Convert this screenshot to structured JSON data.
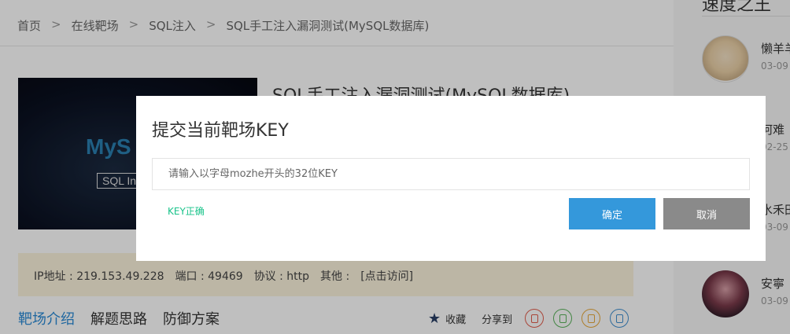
{
  "breadcrumb": {
    "items": [
      "首页",
      "在线靶场",
      "SQL注入",
      "SQL手工注入漏洞测试(MySQL数据库)"
    ],
    "separator": ">"
  },
  "hero": {
    "logo_text": "MyS",
    "sub_text": "SQL In"
  },
  "page_title": "SQL手工注入漏洞测试(MySQL数据库)",
  "info": {
    "ip": "IP地址 : 219.153.49.228",
    "port": "端口 : 49469",
    "protocol": "协议 : http",
    "other_label": "其他 :",
    "visit_link": "[点击访问]"
  },
  "tabs": [
    "靶场介绍",
    "解题思路",
    "防御方案"
  ],
  "actions": {
    "favorite_label": "收藏",
    "share_label": "分享到",
    "share_colors": [
      "#e25c4b",
      "#59b35a",
      "#e8a93a",
      "#3f8fd1"
    ],
    "share_icons": [
      "weibo-icon",
      "wechat-icon",
      "qzone-icon",
      "qq-icon"
    ]
  },
  "sidebar": {
    "title": "速度之王",
    "items": [
      {
        "name": "懒羊羊",
        "date": "03-09"
      },
      {
        "name": "何难",
        "date": "02-25"
      },
      {
        "name": "水禾田",
        "date": "03-09"
      },
      {
        "name": "安寧",
        "date": "03-09"
      }
    ]
  },
  "modal": {
    "title": "提交当前靶场KEY",
    "input_placeholder": "请输入以字母mozhe开头的32位KEY",
    "input_value": "",
    "status_text": "KEY正确",
    "confirm_label": "确定",
    "cancel_label": "取消",
    "accent_color": "#3498db",
    "status_color": "#19c38a"
  }
}
